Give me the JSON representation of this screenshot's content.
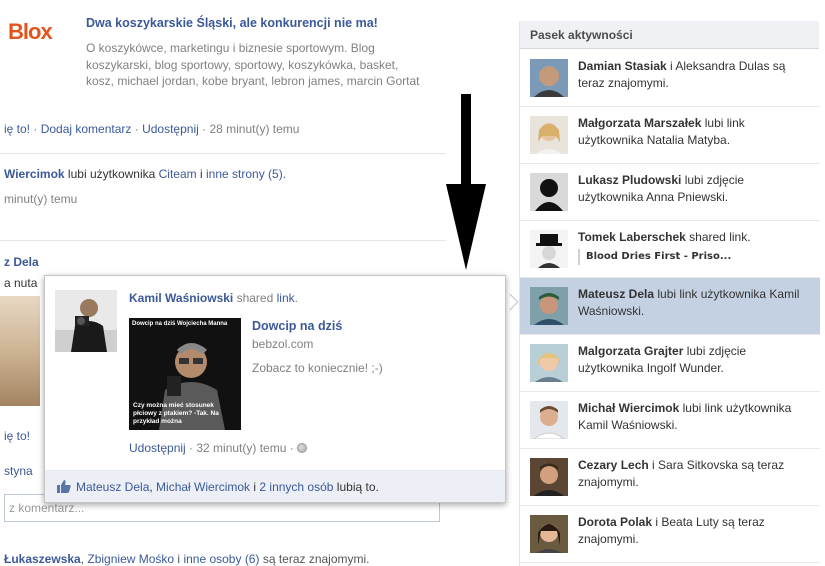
{
  "feed": {
    "logo": "Blox",
    "post1": {
      "title": "Dwa koszykarskie Śląski, ale konkurencji nie ma!",
      "desc": "O koszykówce, marketingu i biznesie sportowym. Blog koszykarski, blog sportowy, sportowy, koszykówka, basket, kosz, michael jordan, kobe bryant, lebron james, marcin Gortat",
      "like": "ię to!",
      "dot1": " · ",
      "comment": "Dodaj komentarz",
      "dot2": " · ",
      "share": "Udostępnij",
      "time": " · 28 minut(y) temu"
    },
    "post2": {
      "name": "Wiercimok",
      "verb": " lubi użytkownika ",
      "target": "Citeam",
      "and": " i ",
      "others": "inne strony (5).",
      "time": "minut(y) temu"
    },
    "post3": {
      "name": "z Dela",
      "line": "a nuta"
    },
    "like_frag": "ię to!",
    "name_frag": "styna",
    "comment_placeholder": "z komentarz...",
    "bottom": {
      "name": "Łukaszewska",
      "sep": ", ",
      "name2": "Zbigniew Mośko",
      "and": " i ",
      "others": "inne osoby (6)",
      "rest": " są teraz znajomymi."
    }
  },
  "popup": {
    "author": "Kamil Waśniowski",
    "verb": " shared ",
    "link_word": "link",
    "period": ".",
    "thumb_top": "Dowcip na dziś  Wojciecha Manna",
    "thumb_bottom": "Czy można mieć stosunek płciowy z ptakiem? -Tak. Na przykład można",
    "link_title": "Dowcip na dziś",
    "domain": "bebzol.com",
    "desc": "Zobacz to koniecznie! ;-)",
    "share": "Udostępnij",
    "time": " · 32 minut(y) temu · ",
    "likes": {
      "name1": "Mateusz Dela",
      "sep": ", ",
      "name2": "Michał Wiercimok",
      "and": " i ",
      "others": "2 innych osób",
      "rest": " lubią to."
    }
  },
  "ticker": {
    "title": "Pasek aktywności",
    "items": [
      {
        "who": "Damian Stasiak",
        "text": " i Aleksandra Dulas są teraz znajomymi."
      },
      {
        "who": "Małgorzata Marszałek",
        "text": " lubi link użytkownika Natalia Matyba."
      },
      {
        "who": "Lukasz Pludowski",
        "text": " lubi zdjęcie użytkownika Anna Pniewski."
      },
      {
        "who": "Tomek Laberschek",
        "text": " shared link.",
        "quote": "Blood Dries First - Priso..."
      },
      {
        "who": "Mateusz Dela",
        "text": " lubi link użytkownika Kamil Waśniowski."
      },
      {
        "who": "Malgorzata Grajter",
        "text": " lubi zdjęcie użytkownika Ingolf Wunder."
      },
      {
        "who": "Michał Wiercimok",
        "text": " lubi link użytkownika Kamil Waśniowski."
      },
      {
        "who": "Cezary Lech",
        "text": " i Sara Sitkovska są teraz znajomymi."
      },
      {
        "who": "Dorota Polak",
        "text": " i Beata Luty są teraz znajomymi."
      }
    ]
  },
  "colors": {
    "link": "#3b5998",
    "ticker_active": "#c4d1e2",
    "ticker_header": "#eff1f4",
    "likes_bar": "#eceff5",
    "logo": "#e2551f"
  }
}
